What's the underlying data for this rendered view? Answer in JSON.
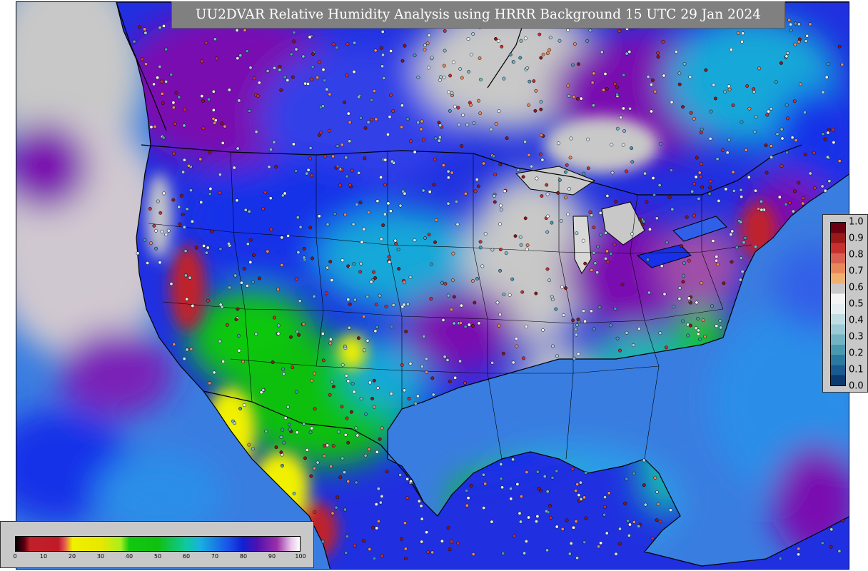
{
  "title": "UU2DVAR Relative Humidity Analysis using HRRR Background 15 UTC 29 Jan 2024",
  "map": {
    "field": "relative humidity",
    "region": "contiguous United States",
    "colors": {
      "ocean": "#3a7de0",
      "dry_red": "#c0202a",
      "yellow": "#f0f000",
      "green": "#10c810",
      "cyan": "#12a8d8",
      "blue": "#1830e8",
      "purple": "#7a10b0",
      "pale_gray": "#c8c8c8",
      "boundary": "#000000"
    }
  },
  "humidity_colorbar": {
    "orientation": "horizontal",
    "placement": "bottom-left",
    "ticks": [
      "0",
      "10",
      "20",
      "30",
      "40",
      "50",
      "60",
      "70",
      "80",
      "90",
      "100"
    ],
    "stops": [
      {
        "v": 0,
        "c": "#000000"
      },
      {
        "v": 3,
        "c": "#5a0010"
      },
      {
        "v": 5,
        "c": "#c0202a"
      },
      {
        "v": 15,
        "c": "#c01a28"
      },
      {
        "v": 17,
        "c": "#e05050"
      },
      {
        "v": 20,
        "c": "#f0f000"
      },
      {
        "v": 30,
        "c": "#e8e800"
      },
      {
        "v": 37,
        "c": "#a8ee20"
      },
      {
        "v": 40,
        "c": "#10c810"
      },
      {
        "v": 50,
        "c": "#10c010"
      },
      {
        "v": 60,
        "c": "#10c8a0"
      },
      {
        "v": 65,
        "c": "#18b0e0"
      },
      {
        "v": 75,
        "c": "#1a50e8"
      },
      {
        "v": 80,
        "c": "#1020d0"
      },
      {
        "v": 85,
        "c": "#5010b0"
      },
      {
        "v": 92,
        "c": "#9a30a8"
      },
      {
        "v": 97,
        "c": "#e8c8e8"
      },
      {
        "v": 100,
        "c": "#ffffff"
      }
    ]
  },
  "station_colorbar": {
    "orientation": "vertical",
    "placement": "right",
    "ticks": [
      "1.0",
      "0.9",
      "0.8",
      "0.7",
      "0.6",
      "0.5",
      "0.4",
      "0.3",
      "0.2",
      "0.1",
      "0.0"
    ],
    "bands": [
      "#6a0010",
      "#9a1818",
      "#c83030",
      "#d86050",
      "#e8885a",
      "#f0b070",
      "#c8c8c8",
      "#f4f4f4",
      "#e6eef2",
      "#c0dde2",
      "#9ccad4",
      "#72b2c2",
      "#4a98b0",
      "#2a7aa0",
      "#1a5a90",
      "#0a3a70"
    ]
  }
}
